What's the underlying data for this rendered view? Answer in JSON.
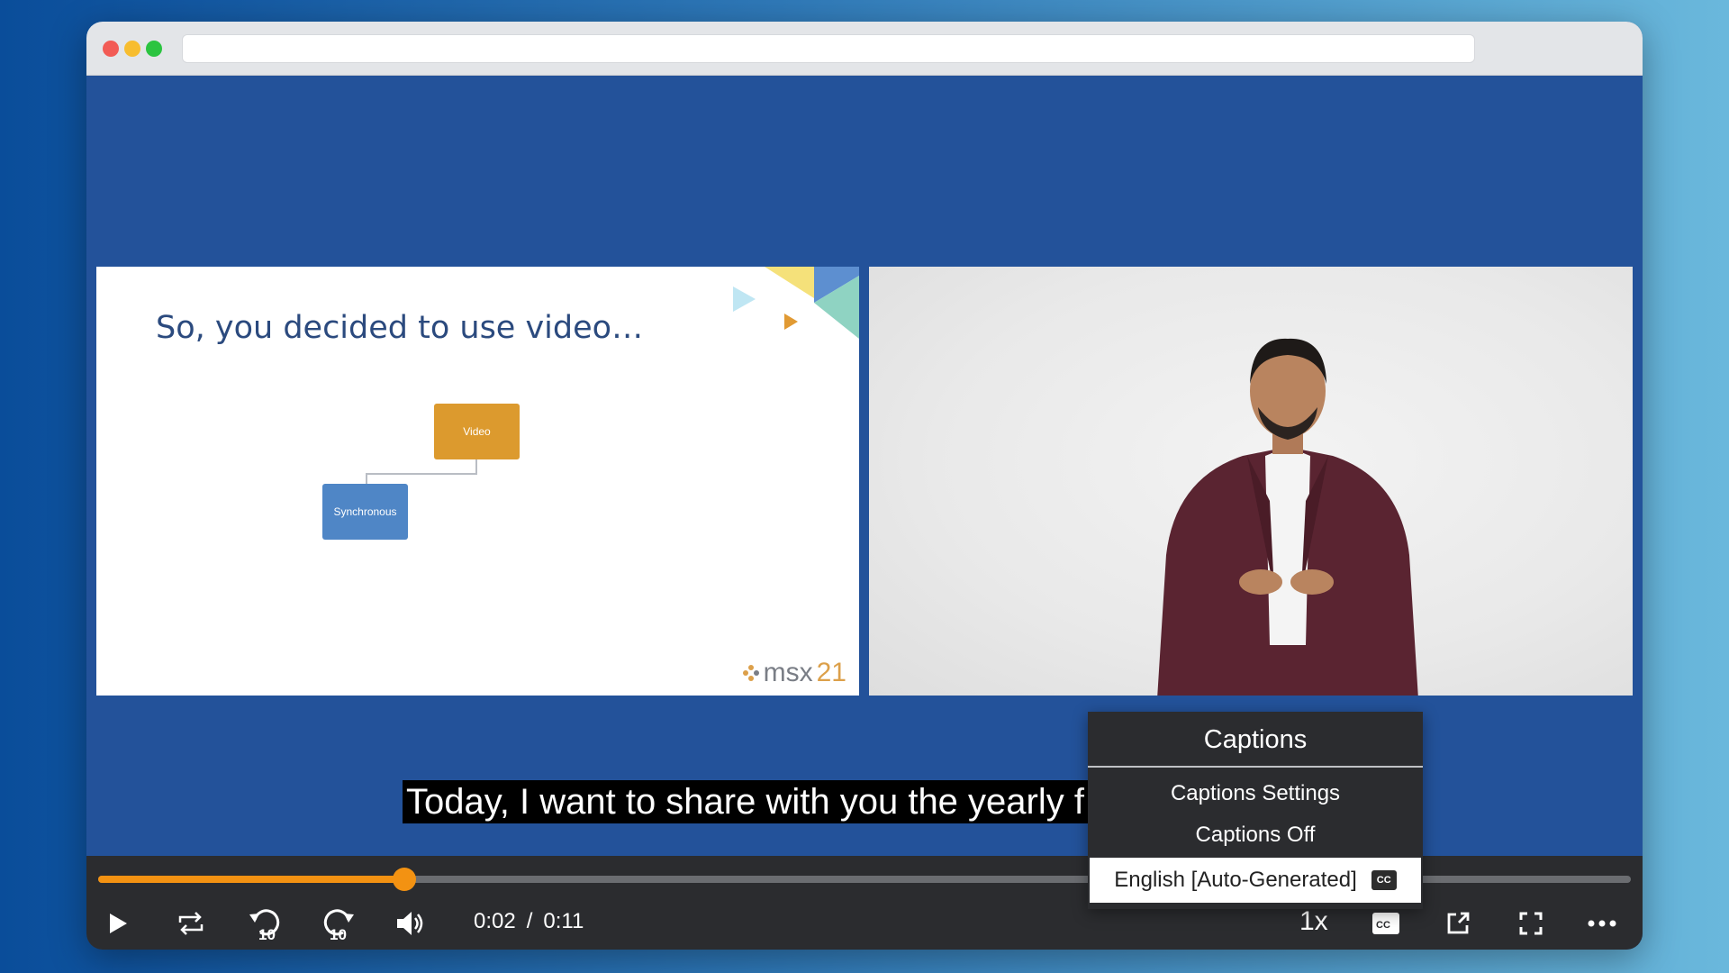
{
  "browser": {
    "url": ""
  },
  "slide": {
    "title": "So, you decided to use video…",
    "boxes": {
      "video": "Video",
      "synchronous": "Synchronous"
    },
    "logo": {
      "text": "msx",
      "number": "21"
    }
  },
  "caption": {
    "text": "Today, I want to share with you the yearly f"
  },
  "captions_menu": {
    "title": "Captions",
    "items": [
      {
        "label": "Captions Settings",
        "selected": false
      },
      {
        "label": "Captions Off",
        "selected": false
      },
      {
        "label": "English [Auto-Generated]",
        "selected": true
      }
    ],
    "cc_badge": "CC"
  },
  "player": {
    "progress": 0.2,
    "current_time": "0:02",
    "time_separator": "/",
    "duration": "0:11",
    "speed": "1x",
    "rewind_label": "10",
    "forward_label": "10",
    "accent_color": "#f39212",
    "icons": [
      "play-icon",
      "loop-icon",
      "rewind-10-icon",
      "forward-10-icon",
      "volume-icon",
      "cc-icon",
      "popout-icon",
      "fullscreen-icon",
      "more-icon"
    ]
  }
}
